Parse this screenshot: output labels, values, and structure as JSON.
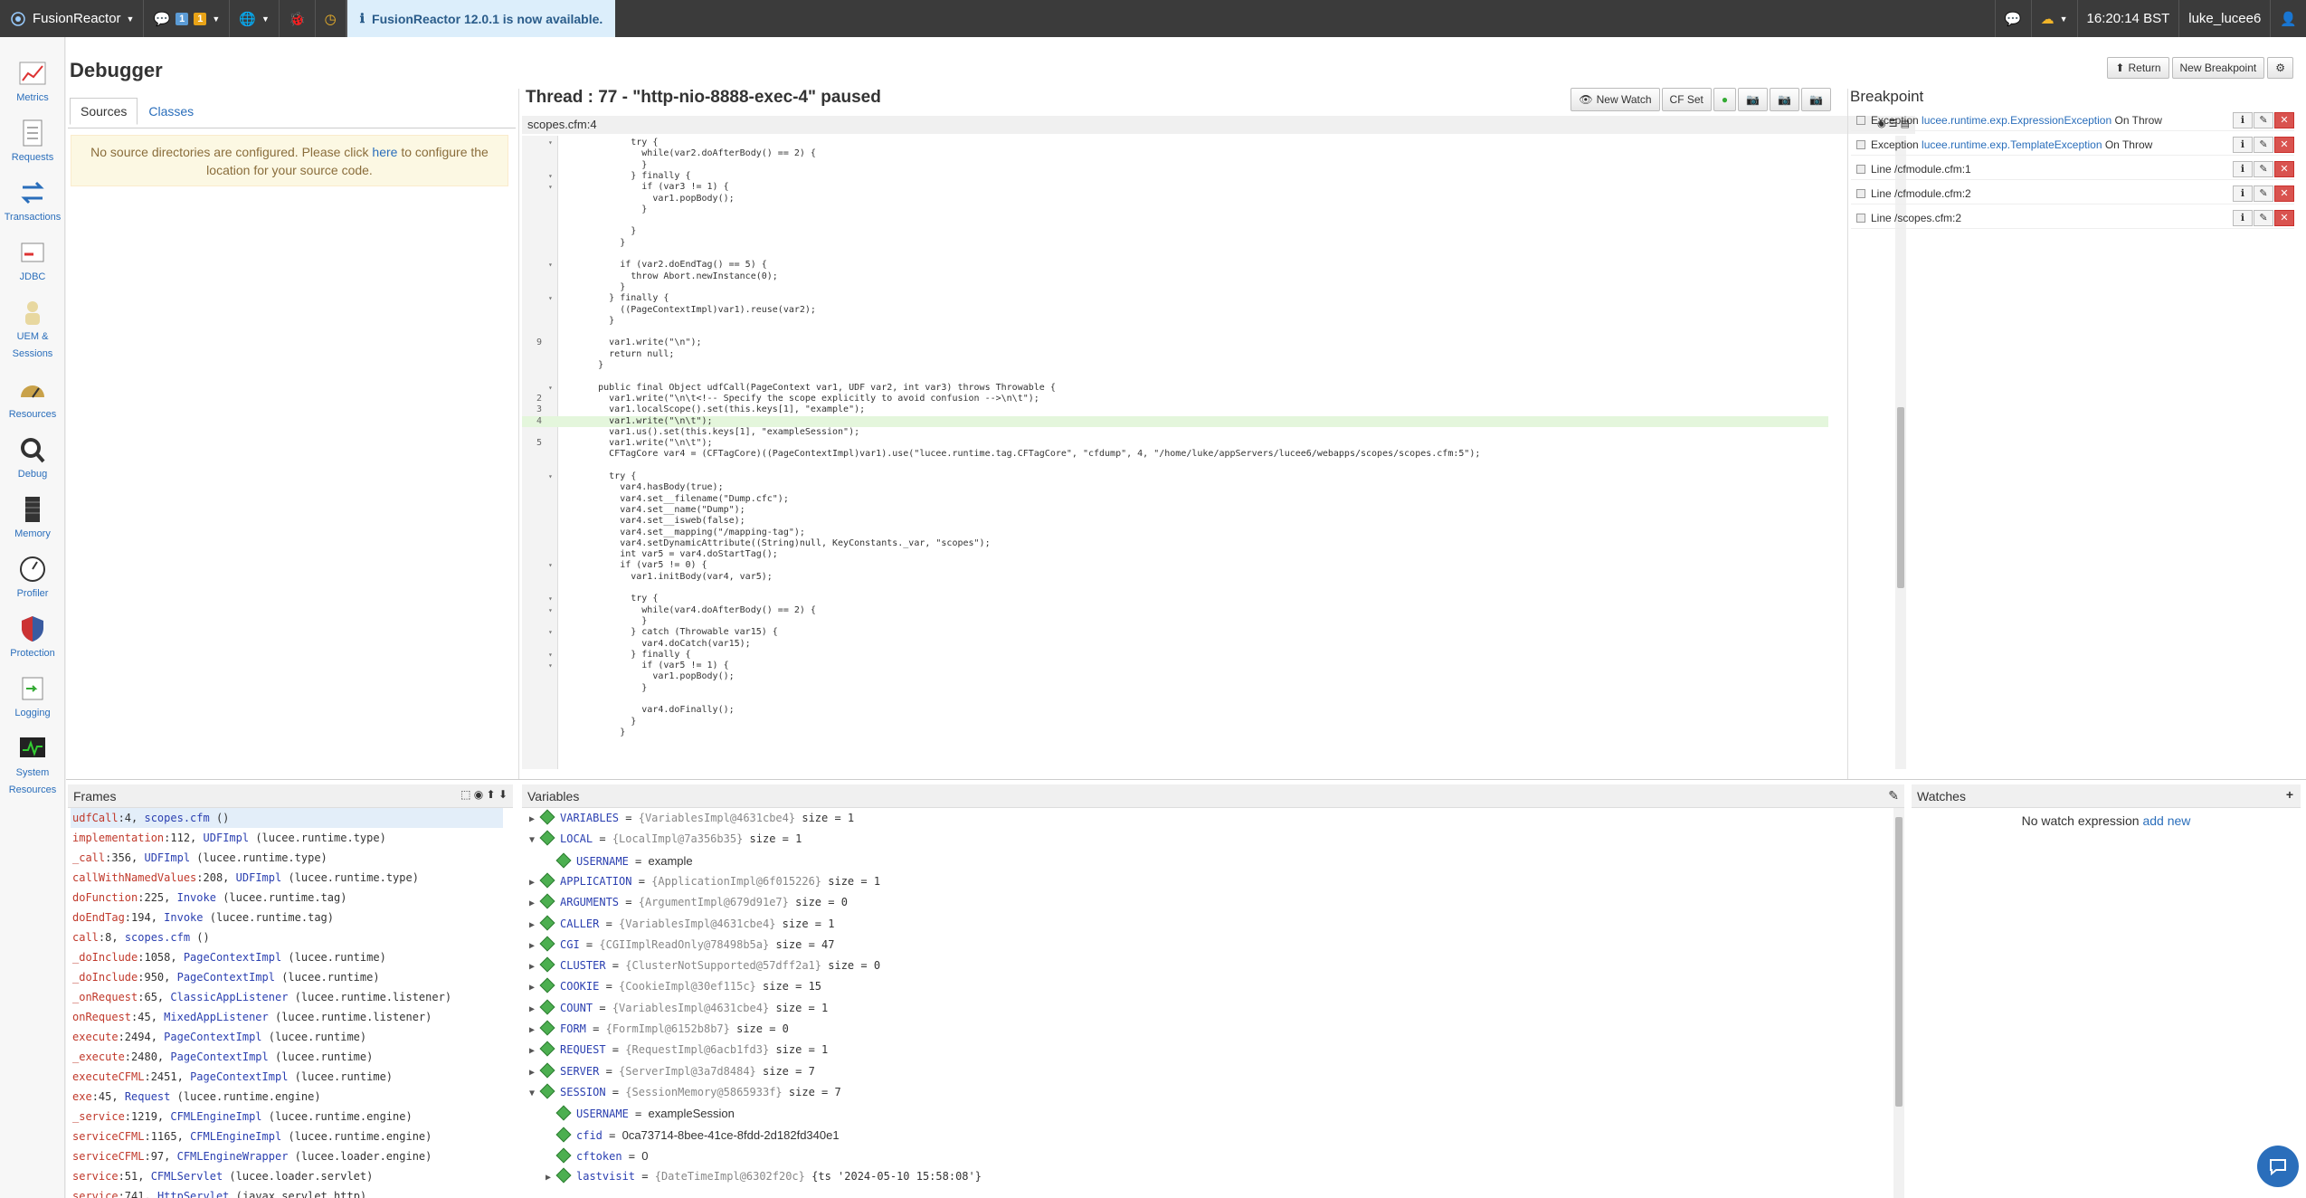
{
  "topbar": {
    "brand": "FusionReactor",
    "badge_a": "1",
    "badge_b": "1",
    "notice": "FusionReactor 12.0.1 is now available.",
    "time": "16:20:14 BST",
    "user": "luke_lucee6"
  },
  "sidebar": {
    "items": [
      {
        "label": "Metrics",
        "icon": "metrics-icon"
      },
      {
        "label": "Requests",
        "icon": "requests-icon"
      },
      {
        "label": "Transactions",
        "icon": "transactions-icon"
      },
      {
        "label": "JDBC",
        "icon": "jdbc-icon"
      },
      {
        "label": "UEM & Sessions",
        "icon": "uem-icon"
      },
      {
        "label": "Resources",
        "icon": "resources-icon"
      },
      {
        "label": "Debug",
        "icon": "debug-icon"
      },
      {
        "label": "Memory",
        "icon": "memory-icon"
      },
      {
        "label": "Profiler",
        "icon": "profiler-icon"
      },
      {
        "label": "Protection",
        "icon": "protection-icon"
      },
      {
        "label": "Logging",
        "icon": "logging-icon"
      },
      {
        "label": "System Resources",
        "icon": "system-resources-icon"
      }
    ]
  },
  "header": {
    "title": "Debugger",
    "return_label": "Return",
    "new_breakpoint_label": "New Breakpoint"
  },
  "sources": {
    "tabs": [
      "Sources",
      "Classes"
    ],
    "alert_pre": "No source directories are configured. Please click ",
    "alert_link": "here",
    "alert_post": " to configure the location for your source code."
  },
  "thread": {
    "title": "Thread : 77 - \"http-nio-8888-exec-4\" paused",
    "new_watch_label": "New Watch",
    "cf_set_label": "CF Set",
    "file": "scopes.cfm:4"
  },
  "code_lines": [
    {
      "ln": "",
      "f": "▾",
      "t": "            try {"
    },
    {
      "ln": "",
      "f": "",
      "t": "              while(var2.doAfterBody() == 2) {"
    },
    {
      "ln": "",
      "f": "",
      "t": "              }"
    },
    {
      "ln": "",
      "f": "▾",
      "t": "            } finally {"
    },
    {
      "ln": "",
      "f": "▾",
      "t": "              if (var3 != 1) {"
    },
    {
      "ln": "",
      "f": "",
      "t": "                var1.popBody();"
    },
    {
      "ln": "",
      "f": "",
      "t": "              }"
    },
    {
      "ln": "",
      "f": "",
      "t": ""
    },
    {
      "ln": "",
      "f": "",
      "t": "            }"
    },
    {
      "ln": "",
      "f": "",
      "t": "          }"
    },
    {
      "ln": "",
      "f": "",
      "t": ""
    },
    {
      "ln": "",
      "f": "▾",
      "t": "          if (var2.doEndTag() == 5) {"
    },
    {
      "ln": "",
      "f": "",
      "t": "            throw Abort.newInstance(0);"
    },
    {
      "ln": "",
      "f": "",
      "t": "          }"
    },
    {
      "ln": "",
      "f": "▾",
      "t": "        } finally {"
    },
    {
      "ln": "",
      "f": "",
      "t": "          ((PageContextImpl)var1).reuse(var2);"
    },
    {
      "ln": "",
      "f": "",
      "t": "        }"
    },
    {
      "ln": "",
      "f": "",
      "t": ""
    },
    {
      "ln": "9",
      "f": "",
      "t": "        var1.write(\"\\n\");"
    },
    {
      "ln": "",
      "f": "",
      "t": "        return null;"
    },
    {
      "ln": "",
      "f": "",
      "t": "      }"
    },
    {
      "ln": "",
      "f": "",
      "t": ""
    },
    {
      "ln": "",
      "f": "▾",
      "t": "      public final Object udfCall(PageContext var1, UDF var2, int var3) throws Throwable {"
    },
    {
      "ln": "2",
      "f": "",
      "t": "        var1.write(\"\\n\\t<!-- Specify the scope explicitly to avoid confusion -->\\n\\t\");"
    },
    {
      "ln": "3",
      "f": "",
      "t": "        var1.localScope().set(this.keys[1], \"example\");"
    },
    {
      "ln": "4",
      "f": "",
      "t": "        var1.write(\"\\n\\t\");"
    },
    {
      "ln": "",
      "f": "",
      "t": "        var1.us().set(this.keys[1], \"exampleSession\");"
    },
    {
      "ln": "5",
      "f": "",
      "t": "        var1.write(\"\\n\\t\");"
    },
    {
      "ln": "",
      "f": "",
      "t": "        CFTagCore var4 = (CFTagCore)((PageContextImpl)var1).use(\"lucee.runtime.tag.CFTagCore\", \"cfdump\", 4, \"/home/luke/appServers/lucee6/webapps/scopes/scopes.cfm:5\");"
    },
    {
      "ln": "",
      "f": "",
      "t": ""
    },
    {
      "ln": "",
      "f": "▾",
      "t": "        try {"
    },
    {
      "ln": "",
      "f": "",
      "t": "          var4.hasBody(true);"
    },
    {
      "ln": "",
      "f": "",
      "t": "          var4.set__filename(\"Dump.cfc\");"
    },
    {
      "ln": "",
      "f": "",
      "t": "          var4.set__name(\"Dump\");"
    },
    {
      "ln": "",
      "f": "",
      "t": "          var4.set__isweb(false);"
    },
    {
      "ln": "",
      "f": "",
      "t": "          var4.set__mapping(\"/mapping-tag\");"
    },
    {
      "ln": "",
      "f": "",
      "t": "          var4.setDynamicAttribute((String)null, KeyConstants._var, \"scopes\");"
    },
    {
      "ln": "",
      "f": "",
      "t": "          int var5 = var4.doStartTag();"
    },
    {
      "ln": "",
      "f": "▾",
      "t": "          if (var5 != 0) {"
    },
    {
      "ln": "",
      "f": "",
      "t": "            var1.initBody(var4, var5);"
    },
    {
      "ln": "",
      "f": "",
      "t": ""
    },
    {
      "ln": "",
      "f": "▾",
      "t": "            try {"
    },
    {
      "ln": "",
      "f": "▾",
      "t": "              while(var4.doAfterBody() == 2) {"
    },
    {
      "ln": "",
      "f": "",
      "t": "              }"
    },
    {
      "ln": "",
      "f": "▾",
      "t": "            } catch (Throwable var15) {"
    },
    {
      "ln": "",
      "f": "",
      "t": "              var4.doCatch(var15);"
    },
    {
      "ln": "",
      "f": "▾",
      "t": "            } finally {"
    },
    {
      "ln": "",
      "f": "▾",
      "t": "              if (var5 != 1) {"
    },
    {
      "ln": "",
      "f": "",
      "t": "                var1.popBody();"
    },
    {
      "ln": "",
      "f": "",
      "t": "              }"
    },
    {
      "ln": "",
      "f": "",
      "t": ""
    },
    {
      "ln": "",
      "f": "",
      "t": "              var4.doFinally();"
    },
    {
      "ln": "",
      "f": "",
      "t": "            }"
    },
    {
      "ln": "",
      "f": "",
      "t": "          }"
    }
  ],
  "breakpoints": {
    "title": "Breakpoint",
    "items": [
      {
        "pre": "Exception ",
        "link": "lucee.runtime.exp.ExpressionException",
        "post": " On Throw"
      },
      {
        "pre": "Exception ",
        "link": "lucee.runtime.exp.TemplateException",
        "post": " On Throw"
      },
      {
        "pre": "Line /cfmodule.cfm:1",
        "link": "",
        "post": ""
      },
      {
        "pre": "Line /cfmodule.cfm:2",
        "link": "",
        "post": ""
      },
      {
        "pre": "Line /scopes.cfm:2",
        "link": "",
        "post": ""
      }
    ]
  },
  "frames": {
    "title": "Frames",
    "items": [
      {
        "m": "udfCall",
        "n": ":4, ",
        "c": "scopes.cfm",
        "p": " ()"
      },
      {
        "m": "implementation",
        "n": ":112, ",
        "c": "UDFImpl",
        "p": " (lucee.runtime.type)"
      },
      {
        "m": "_call",
        "n": ":356, ",
        "c": "UDFImpl",
        "p": " (lucee.runtime.type)"
      },
      {
        "m": "callWithNamedValues",
        "n": ":208, ",
        "c": "UDFImpl",
        "p": " (lucee.runtime.type)"
      },
      {
        "m": "doFunction",
        "n": ":225, ",
        "c": "Invoke",
        "p": " (lucee.runtime.tag)"
      },
      {
        "m": "doEndTag",
        "n": ":194, ",
        "c": "Invoke",
        "p": " (lucee.runtime.tag)"
      },
      {
        "m": "call",
        "n": ":8, ",
        "c": "scopes.cfm",
        "p": " ()"
      },
      {
        "m": "_doInclude",
        "n": ":1058, ",
        "c": "PageContextImpl",
        "p": " (lucee.runtime)"
      },
      {
        "m": "_doInclude",
        "n": ":950, ",
        "c": "PageContextImpl",
        "p": " (lucee.runtime)"
      },
      {
        "m": "_onRequest",
        "n": ":65, ",
        "c": "ClassicAppListener",
        "p": " (lucee.runtime.listener)"
      },
      {
        "m": "onRequest",
        "n": ":45, ",
        "c": "MixedAppListener",
        "p": " (lucee.runtime.listener)"
      },
      {
        "m": "execute",
        "n": ":2494, ",
        "c": "PageContextImpl",
        "p": " (lucee.runtime)"
      },
      {
        "m": "_execute",
        "n": ":2480, ",
        "c": "PageContextImpl",
        "p": " (lucee.runtime)"
      },
      {
        "m": "executeCFML",
        "n": ":2451, ",
        "c": "PageContextImpl",
        "p": " (lucee.runtime)"
      },
      {
        "m": "exe",
        "n": ":45, ",
        "c": "Request",
        "p": " (lucee.runtime.engine)"
      },
      {
        "m": "_service",
        "n": ":1219, ",
        "c": "CFMLEngineImpl",
        "p": " (lucee.runtime.engine)"
      },
      {
        "m": "serviceCFML",
        "n": ":1165, ",
        "c": "CFMLEngineImpl",
        "p": " (lucee.runtime.engine)"
      },
      {
        "m": "serviceCFML",
        "n": ":97, ",
        "c": "CFMLEngineWrapper",
        "p": " (lucee.loader.engine)"
      },
      {
        "m": "service",
        "n": ":51, ",
        "c": "CFMLServlet",
        "p": " (lucee.loader.servlet)"
      },
      {
        "m": "service",
        "n": ":741, ",
        "c": "HttpServlet",
        "p": " (javax.servlet.http)"
      }
    ]
  },
  "variables": {
    "title": "Variables",
    "items": [
      {
        "indent": 0,
        "arrow": "▶",
        "name": "VARIABLES",
        "ref": "{VariablesImpl@4631cbe4}",
        "size": "size = 1"
      },
      {
        "indent": 0,
        "arrow": "▼",
        "name": "LOCAL",
        "ref": "{LocalImpl@7a356b35}",
        "size": "size = 1"
      },
      {
        "indent": 1,
        "arrow": "",
        "name": "USERNAME",
        "ref": "",
        "size": "",
        "value": "example"
      },
      {
        "indent": 0,
        "arrow": "▶",
        "name": "APPLICATION",
        "ref": "{ApplicationImpl@6f015226}",
        "size": "size = 1"
      },
      {
        "indent": 0,
        "arrow": "▶",
        "name": "ARGUMENTS",
        "ref": "{ArgumentImpl@679d91e7}",
        "size": "size = 0"
      },
      {
        "indent": 0,
        "arrow": "▶",
        "name": "CALLER",
        "ref": "{VariablesImpl@4631cbe4}",
        "size": "size = 1"
      },
      {
        "indent": 0,
        "arrow": "▶",
        "name": "CGI",
        "ref": "{CGIImplReadOnly@78498b5a}",
        "size": "size = 47"
      },
      {
        "indent": 0,
        "arrow": "▶",
        "name": "CLUSTER",
        "ref": "{ClusterNotSupported@57dff2a1}",
        "size": "size = 0"
      },
      {
        "indent": 0,
        "arrow": "▶",
        "name": "COOKIE",
        "ref": "{CookieImpl@30ef115c}",
        "size": "size = 15"
      },
      {
        "indent": 0,
        "arrow": "▶",
        "name": "COUNT",
        "ref": "{VariablesImpl@4631cbe4}",
        "size": "size = 1"
      },
      {
        "indent": 0,
        "arrow": "▶",
        "name": "FORM",
        "ref": "{FormImpl@6152b8b7}",
        "size": "size = 0"
      },
      {
        "indent": 0,
        "arrow": "▶",
        "name": "REQUEST",
        "ref": "{RequestImpl@6acb1fd3}",
        "size": "size = 1"
      },
      {
        "indent": 0,
        "arrow": "▶",
        "name": "SERVER",
        "ref": "{ServerImpl@3a7d8484}",
        "size": "size = 7"
      },
      {
        "indent": 0,
        "arrow": "▼",
        "name": "SESSION",
        "ref": "{SessionMemory@5865933f}",
        "size": "size = 7"
      },
      {
        "indent": 1,
        "arrow": "",
        "name": "USERNAME",
        "ref": "",
        "size": "",
        "value": "exampleSession"
      },
      {
        "indent": 1,
        "arrow": "",
        "name": "cfid",
        "ref": "",
        "size": "",
        "value": "0ca73714-8bee-41ce-8fdd-2d182fd340e1"
      },
      {
        "indent": 1,
        "arrow": "",
        "name": "cftoken",
        "ref": "",
        "size": "",
        "value": "0"
      },
      {
        "indent": 1,
        "arrow": "▶",
        "name": "lastvisit",
        "ref": "{DateTimeImpl@6302f20c}",
        "size": "{ts '2024-05-10 15:58:08'}"
      }
    ]
  },
  "watches": {
    "title": "Watches",
    "empty": "No watch expression",
    "add": "add new"
  }
}
